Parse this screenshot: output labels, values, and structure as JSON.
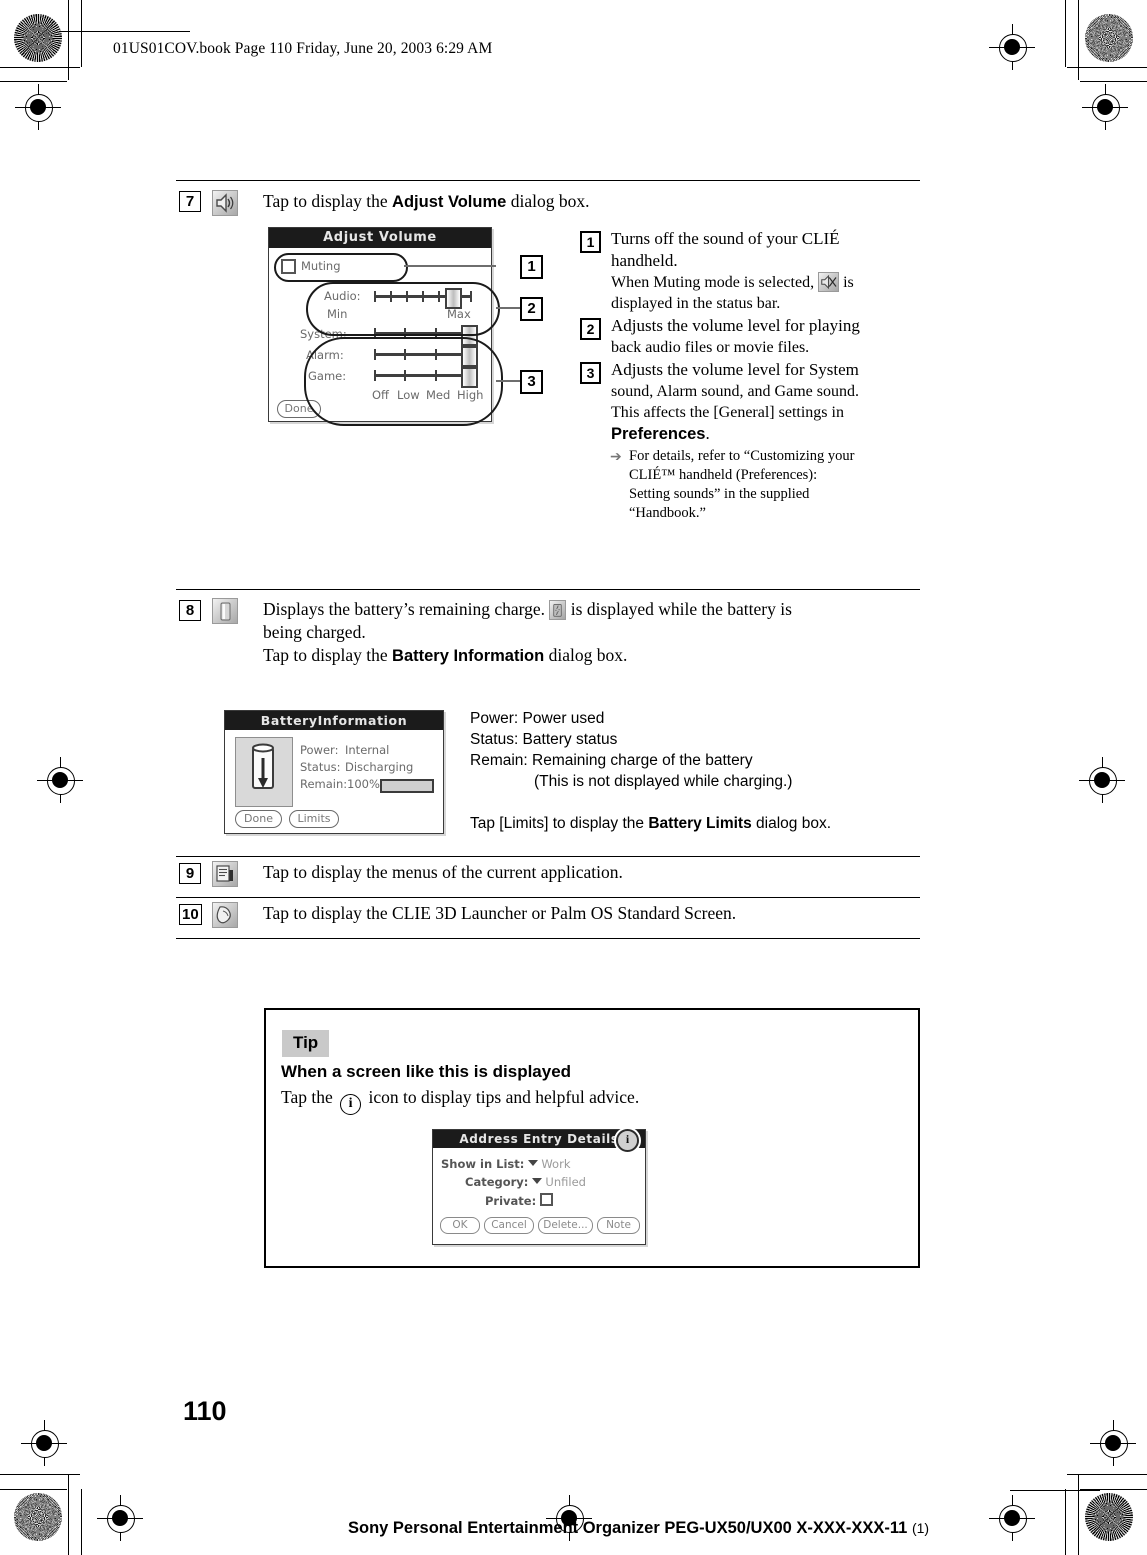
{
  "header": {
    "file_info": "01US01COV.book  Page 110  Friday, June 20, 2003  6:29 AM"
  },
  "sections": [
    {
      "number": "7",
      "icon": "speaker-icon",
      "text_before": "Tap to display the ",
      "text_bold": "Adjust Volume",
      "text_after": " dialog box."
    },
    {
      "number": "8",
      "icon": "battery-icon",
      "line1_a": "Displays the battery’s remaining charge. ",
      "line1_b": " is displayed while the battery is",
      "line2": "being charged.",
      "line3_a": "Tap to display the ",
      "line3_bold": "Battery Information",
      "line3_b": " dialog box."
    },
    {
      "number": "9",
      "icon": "menu-icon",
      "text": "Tap to display the menus of the current application."
    },
    {
      "number": "10",
      "icon": "home-launcher-icon",
      "text": "Tap to display the CLIE 3D Launcher or Palm OS Standard Screen."
    }
  ],
  "volume_dialog": {
    "title": "Adjust Volume",
    "muting_label": "Muting",
    "audio_label": "Audio:",
    "min_label": "Min",
    "max_label": "Max",
    "system_label": "System:",
    "alarm_label": "Alarm:",
    "game_label": "Game:",
    "scale": [
      "Off",
      "Low",
      "Med",
      "High"
    ],
    "done_button": "Done",
    "callouts": [
      "1",
      "2",
      "3"
    ]
  },
  "volume_explanations": [
    {
      "num": "1",
      "line1": "Turns off the sound of your CLIÉ",
      "line2": "handheld.",
      "line3_a": "When Muting mode is selected, ",
      "line3_b": " is",
      "line4": "displayed in the status bar.",
      "icon": "muted-speaker-icon"
    },
    {
      "num": "2",
      "line1": "Adjusts the volume level for playing",
      "line2": "back audio files or movie files."
    },
    {
      "num": "3",
      "line1": "Adjusts the volume level for System",
      "line2": "sound, Alarm sound, and Game sound.",
      "line3": "This affects the [General] settings in",
      "line4_bold": "Preferences",
      "line4_after": ".",
      "note_line1": "For details, refer to “Customizing your",
      "note_line2": "CLIÉ™ handheld (Preferences):",
      "note_line3": "Setting sounds” in the supplied",
      "note_line4": "“Handbook.”"
    }
  ],
  "battery_dialog": {
    "title": "BatteryInformation",
    "power_label": "Power:",
    "power_value": "Internal",
    "status_label": "Status:",
    "status_value": "Discharging",
    "remain_label": "Remain:",
    "remain_value": "100%",
    "done_button": "Done",
    "limits_button": "Limits"
  },
  "battery_legend": {
    "line1": "Power: Power used",
    "line2": "Status: Battery status",
    "line3": "Remain: Remaining charge of the battery",
    "line4": "(This is not displayed while charging.)",
    "line5_a": "Tap [Limits] to display the ",
    "line5_bold": "Battery Limits",
    "line5_b": " dialog box."
  },
  "tip": {
    "badge": "Tip",
    "heading": "When a screen like this is displayed",
    "text_before": "Tap the ",
    "icon_glyph": "i",
    "text_after": " icon to display tips and helpful advice."
  },
  "address_dialog": {
    "title": "Address Entry Details",
    "show_in_list_label": "Show in List:",
    "show_in_list_value": "Work",
    "category_label": "Category:",
    "category_value": "Unfiled",
    "private_label": "Private:",
    "buttons": [
      "OK",
      "Cancel",
      "Delete...",
      "Note"
    ],
    "info_icon": "i"
  },
  "footer": {
    "page_number": "110",
    "text": "Sony Personal Entertainment Organizer  PEG-UX50/UX00  X-XXX-XXX-11",
    "revision": "(1)"
  }
}
